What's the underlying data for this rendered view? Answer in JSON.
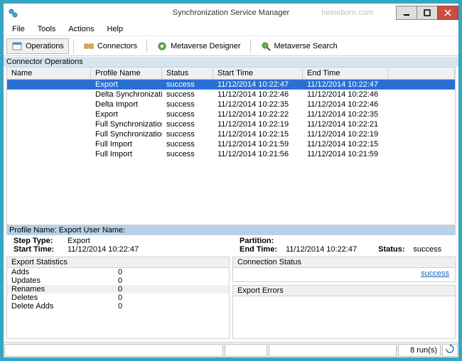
{
  "window": {
    "title": "Synchronization Service Manager",
    "brand": "heineborn.com"
  },
  "menu": {
    "items": [
      "File",
      "Tools",
      "Actions",
      "Help"
    ]
  },
  "toolbar": {
    "operations": "Operations",
    "connectors": "Connectors",
    "metaverse_designer": "Metaverse Designer",
    "metaverse_search": "Metaverse Search"
  },
  "grid": {
    "section": "Connector Operations",
    "headers": {
      "name": "Name",
      "profile": "Profile Name",
      "status": "Status",
      "start": "Start Time",
      "end": "End Time"
    },
    "rows": [
      {
        "name": "",
        "profile": "Export",
        "status": "success",
        "start": "11/12/2014 10:22:47",
        "end": "11/12/2014 10:22:47",
        "selected": true
      },
      {
        "name": "",
        "profile": "Delta Synchronization",
        "status": "success",
        "start": "11/12/2014 10:22:46",
        "end": "11/12/2014 10:22:46"
      },
      {
        "name": "",
        "profile": "Delta Import",
        "status": "success",
        "start": "11/12/2014 10:22:35",
        "end": "11/12/2014 10:22:46"
      },
      {
        "name": "",
        "profile": "Export",
        "status": "success",
        "start": "11/12/2014 10:22:22",
        "end": "11/12/2014 10:22:35"
      },
      {
        "name": "",
        "profile": "Full Synchronization",
        "status": "success",
        "start": "11/12/2014 10:22:19",
        "end": "11/12/2014 10:22:21"
      },
      {
        "name": "",
        "profile": "Full Synchronization",
        "status": "success",
        "start": "11/12/2014 10:22:15",
        "end": "11/12/2014 10:22:19"
      },
      {
        "name": "",
        "profile": "Full Import",
        "status": "success",
        "start": "11/12/2014 10:21:59",
        "end": "11/12/2014 10:22:15"
      },
      {
        "name": "",
        "profile": "Full Import",
        "status": "success",
        "start": "11/12/2014 10:21:56",
        "end": "11/12/2014 10:21:59"
      }
    ]
  },
  "details": {
    "profile_line": "Profile Name: Export   User Name:",
    "left": {
      "step_type_label": "Step Type:",
      "step_type": "Export",
      "start_time_label": "Start Time:",
      "start_time": "11/12/2014 10:22:47",
      "stats_title": "Export Statistics",
      "stats": [
        {
          "k": "Adds",
          "v": "0"
        },
        {
          "k": "Updates",
          "v": "0"
        },
        {
          "k": "Renames",
          "v": "0",
          "alt": true
        },
        {
          "k": "Deletes",
          "v": "0"
        },
        {
          "k": "Delete Adds",
          "v": "0"
        }
      ]
    },
    "right": {
      "partition_label": "Partition:",
      "end_time_label": "End Time:",
      "end_time": "11/12/2014 10:22:47",
      "status_label": "Status:",
      "status": "success",
      "conn_status_title": "Connection Status",
      "conn_status_link": "success",
      "export_errors_title": "Export Errors"
    }
  },
  "statusbar": {
    "runs": "8 run(s)"
  }
}
